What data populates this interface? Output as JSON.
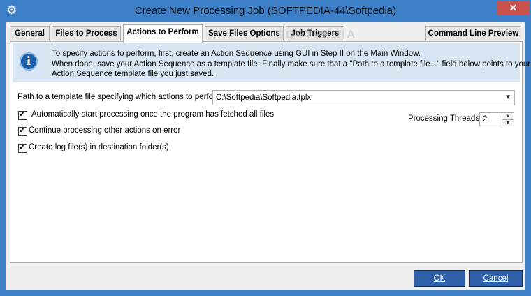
{
  "window": {
    "title": "Create New Processing Job (SOFTPEDIA-44\\Softpedia)",
    "close_label": "✕",
    "app_icon": "gear-icon"
  },
  "tabs": [
    {
      "label": "General"
    },
    {
      "label": "Files to Process"
    },
    {
      "label": "Actions to Perform",
      "active": true
    },
    {
      "label": "Save Files Options"
    },
    {
      "label": "Job Triggers"
    },
    {
      "label": "Command Line Preview"
    }
  ],
  "info": {
    "icon": "info-icon",
    "lines": [
      "To specify actions to perform, first, create an Action Sequence using GUI in Step II on the Main Window.",
      "When done, save your Action Sequence as a template file. Finally make sure that a \"Path to a template file...\" field below points to your",
      "Action Sequence template file you just saved."
    ]
  },
  "template": {
    "label": "Path to a template file specifying which actions to perform:",
    "value": "C:\\Softpedia\\Softpedia.tplx"
  },
  "options": {
    "auto_start": {
      "label": "Automatically start processing once the program has fetched all files",
      "checked": true
    },
    "continue_on_error": {
      "label": "Continue processing other actions on error",
      "checked": true
    },
    "create_log": {
      "label": "Create log file(s) in destination folder(s)",
      "checked": true
    }
  },
  "threads": {
    "label": "Processing Threads:",
    "value": "2"
  },
  "buttons": {
    "ok": "OK",
    "cancel": "Cancel"
  },
  "watermark": "SOFTPEDIA",
  "colors": {
    "title_bar": "#3c7fc6",
    "close_button": "#c7504a",
    "info_bar": "#d8e5f3",
    "button": "#2e5fa8"
  }
}
